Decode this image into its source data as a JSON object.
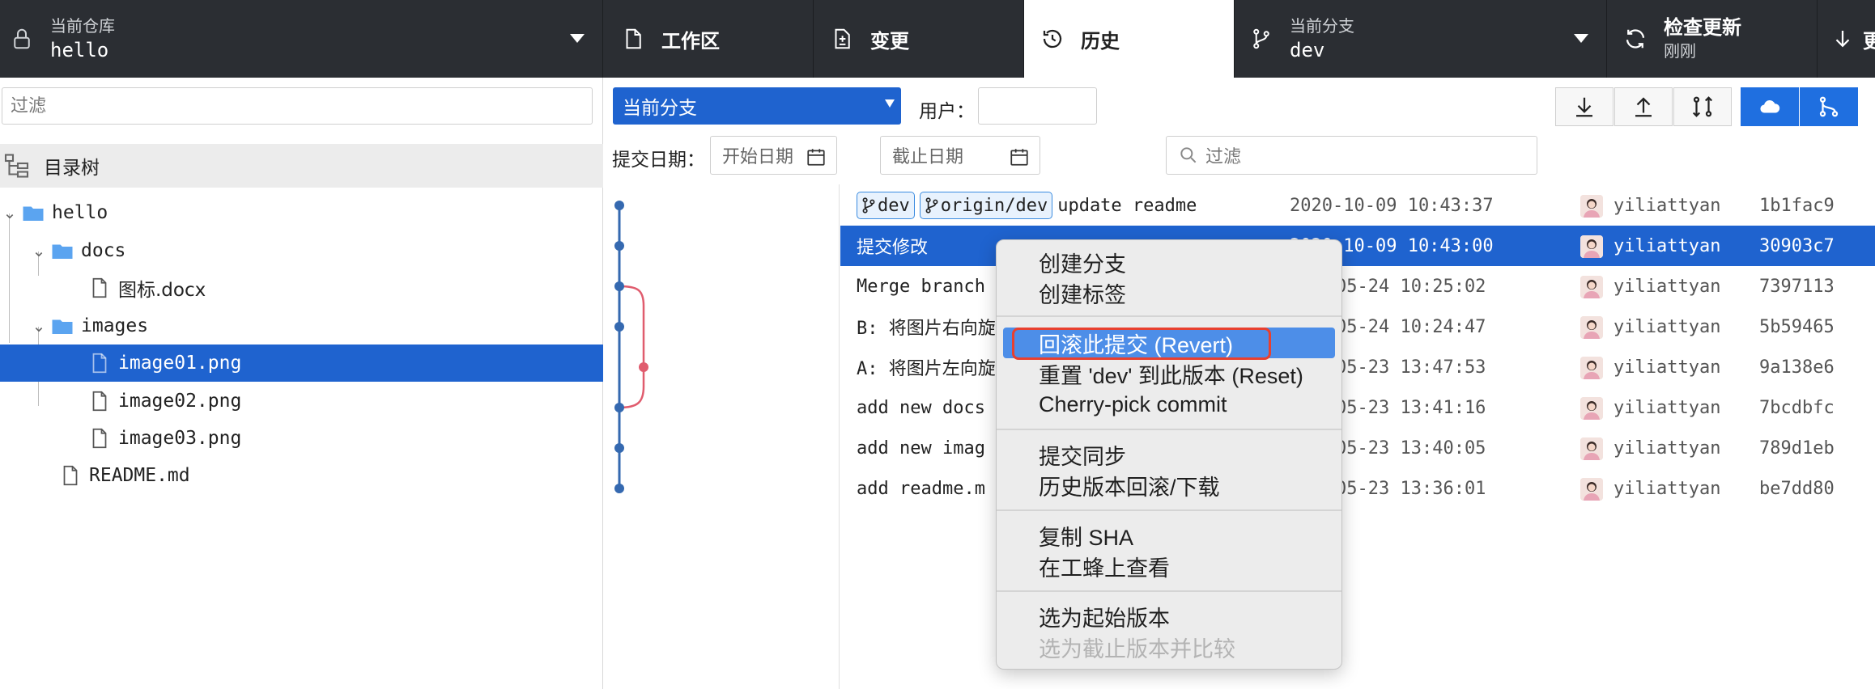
{
  "topbar": {
    "repo_caption": "当前仓库",
    "repo_name": "hello",
    "tab_workspace": "工作区",
    "tab_changes": "变更",
    "tab_history": "历史",
    "branch_caption": "当前分支",
    "branch_name": "dev",
    "update_title": "检查更新",
    "update_sub": "刚刚",
    "next_partial": "更"
  },
  "left": {
    "filter_placeholder": "过滤",
    "tree_title": "目录树",
    "tree": [
      {
        "label": "hello",
        "type": "folder"
      },
      {
        "label": "docs",
        "type": "folder"
      },
      {
        "label": "图标.docx",
        "type": "file"
      },
      {
        "label": "images",
        "type": "folder"
      },
      {
        "label": "image01.png",
        "type": "file",
        "selected": true
      },
      {
        "label": "image02.png",
        "type": "file"
      },
      {
        "label": "image03.png",
        "type": "file"
      },
      {
        "label": "README.md",
        "type": "file"
      }
    ]
  },
  "toolbar": {
    "branch_select": "当前分支",
    "user_label": "用户：",
    "date_label": "提交日期：",
    "start_date_placeholder": "开始日期",
    "end_date_placeholder": "截止日期",
    "filter_placeholder": "过滤"
  },
  "commits": [
    {
      "tags": [
        "dev",
        "origin/dev"
      ],
      "message": "update readme",
      "date": "2020-10-09 10:43:37",
      "author": "yiliattyan",
      "sha": "1b1fac9"
    },
    {
      "message": "提交修改",
      "date": "2020-10-09 10:43:00",
      "author": "yiliattyan",
      "sha": "30903c7",
      "selected": true
    },
    {
      "message": "Merge branch",
      "date": "05-24 10:25:02",
      "author": "yiliattyan",
      "sha": "7397113"
    },
    {
      "message": "B: 将图片右向旋",
      "date": "05-24 10:24:47",
      "author": "yiliattyan",
      "sha": "5b59465"
    },
    {
      "message": "A: 将图片左向旋",
      "date": "05-23 13:47:53",
      "author": "yiliattyan",
      "sha": "9a138e6"
    },
    {
      "message": "add new docs",
      "date": "05-23 13:41:16",
      "author": "yiliattyan",
      "sha": "7bcdbfc"
    },
    {
      "message": "add new imag",
      "date": "05-23 13:40:05",
      "author": "yiliattyan",
      "sha": "789d1eb"
    },
    {
      "message": "add readme.m",
      "date": "05-23 13:36:01",
      "author": "yiliattyan",
      "sha": "be7dd80"
    }
  ],
  "context_menu": {
    "items": [
      "创建分支",
      "创建标签",
      "回滚此提交 (Revert)",
      "重置 'dev' 到此版本 (Reset)",
      "Cherry-pick commit",
      "提交同步",
      "历史版本回滚/下载",
      "复制 SHA",
      "在工蜂上查看",
      "选为起始版本",
      "选为截止版本并比较"
    ],
    "active_item": "回滚此提交 (Revert)",
    "disabled_item": "选为截止版本并比较"
  },
  "colors": {
    "topbar_bg": "#2b2e33",
    "selection_blue": "#1f63cf",
    "menu_highlight": "#4d8ee8",
    "annotation_red": "#e8402f",
    "graph_main": "#3569b0",
    "graph_merge": "#e05c6e"
  }
}
